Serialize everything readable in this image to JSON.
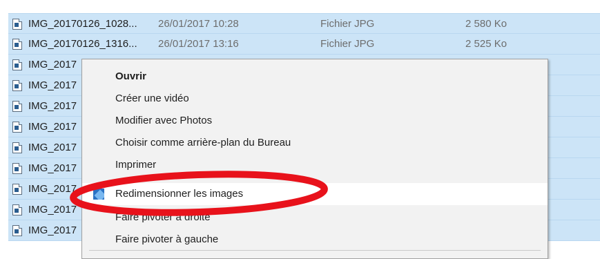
{
  "files": [
    {
      "name": "IMG_20170126_1028...",
      "date": "26/01/2017 10:28",
      "type": "Fichier JPG",
      "size": "2 580 Ko"
    },
    {
      "name": "IMG_20170126_1316...",
      "date": "26/01/2017 13:16",
      "type": "Fichier JPG",
      "size": "2 525 Ko"
    },
    {
      "name": "IMG_2017"
    },
    {
      "name": "IMG_2017"
    },
    {
      "name": "IMG_2017"
    },
    {
      "name": "IMG_2017"
    },
    {
      "name": "IMG_2017"
    },
    {
      "name": "IMG_2017"
    },
    {
      "name": "IMG_2017"
    },
    {
      "name": "IMG_2017"
    },
    {
      "name": "IMG_2017"
    }
  ],
  "context_menu": {
    "items": [
      {
        "label": "Ouvrir",
        "bold": true
      },
      {
        "label": "Créer une vidéo"
      },
      {
        "label": "Modifier avec Photos"
      },
      {
        "label": "Choisir comme arrière-plan du Bureau"
      },
      {
        "label": "Imprimer"
      },
      {
        "label": "Redimensionner les images",
        "icon": "image-resizer-icon",
        "highlighted": true
      },
      {
        "label": "Faire pivoter à droite"
      },
      {
        "label": "Faire pivoter à gauche"
      }
    ]
  },
  "colors": {
    "selection": "#cce4f7",
    "menu_background": "#f2f2f2",
    "annotation_ellipse": "#e8121b"
  }
}
